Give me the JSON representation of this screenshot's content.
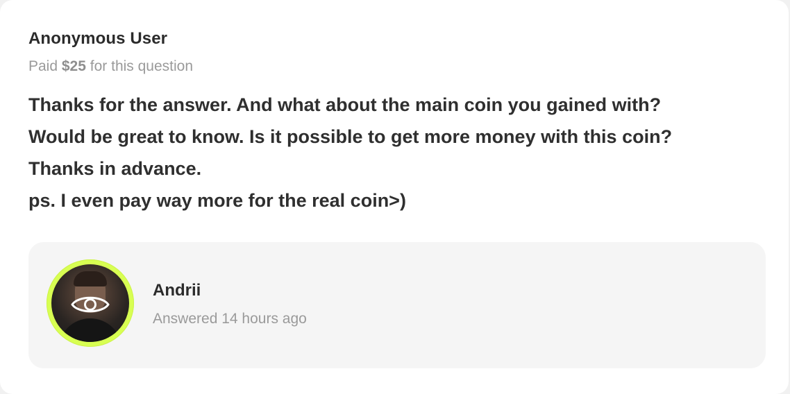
{
  "question": {
    "asker_name": "Anonymous User",
    "paid_prefix": "Paid",
    "paid_amount": "$25",
    "paid_suffix": "for this question",
    "lines": [
      "Thanks for the answer. And what about the main coin you gained with?",
      "Would be great to know. Is it possible to get more money with this coin?",
      "Thanks in advance.",
      "ps. I even pay way more for the real coin>)"
    ]
  },
  "answer": {
    "answerer_name": "Andrii",
    "answered_time": "Answered 14 hours ago",
    "avatar_icon": "eye-icon",
    "avatar_ring_color": "#d8ff52"
  }
}
